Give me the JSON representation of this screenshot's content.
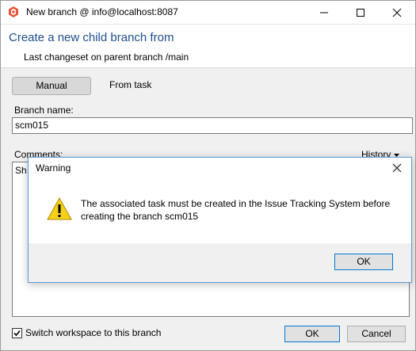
{
  "window": {
    "title": "New branch @ info@localhost:8087",
    "icon": "plastic-scm-app-icon",
    "controls": [
      "minimize-icon",
      "maximize-icon",
      "close-icon"
    ]
  },
  "header": {
    "title": "Create a new child branch from",
    "subtitle": "Last changeset on parent branch /main",
    "title_color": "#1f4e8c"
  },
  "tabs": [
    {
      "label": "Manual",
      "selected": true
    },
    {
      "label": "From task",
      "selected": false
    }
  ],
  "form": {
    "branch_name_label": "Branch name:",
    "branch_name_value": "scm015",
    "comments_label": "Comments:",
    "history_label": "History",
    "comments_visible_text": "Sh"
  },
  "footer": {
    "switch_workspace_label": "Switch workspace to this branch",
    "switch_workspace_checked": true,
    "ok_label": "OK",
    "cancel_label": "Cancel"
  },
  "dialog": {
    "title": "Warning",
    "message": "The associated task must be created in the Issue Tracking System before creating the branch scm015",
    "ok_label": "OK",
    "icon": "warning-icon",
    "accent_color": "#0078d7"
  }
}
